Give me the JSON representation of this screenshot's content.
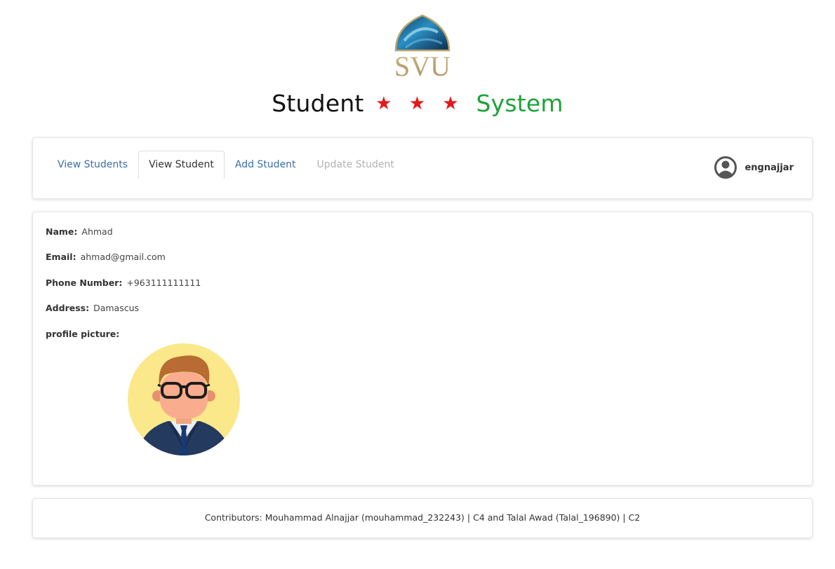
{
  "header": {
    "logo_text": "SVU",
    "title_part1": "Student",
    "title_stars": "★ ★ ★",
    "title_part2": "System"
  },
  "nav": {
    "tabs": [
      {
        "label": "View Students",
        "state": "link"
      },
      {
        "label": "View Student",
        "state": "active"
      },
      {
        "label": "Add Student",
        "state": "link"
      },
      {
        "label": "Update Student",
        "state": "disabled"
      }
    ],
    "user": {
      "name": "engnajjar",
      "icon": "user-circle-icon"
    }
  },
  "student": {
    "name_label": "Name:",
    "name": "Ahmad",
    "email_label": "Email:",
    "email": "ahmad@gmail.com",
    "phone_label": "Phone Number:",
    "phone": "+963111111111",
    "address_label": "Address:",
    "address": "Damascus",
    "picture_label": "profile picture:"
  },
  "footer": {
    "text": "Contributors: Mouhammad Alnajjar (mouhammad_232243) | C4 and Talal Awad (Talal_196890) | C2"
  },
  "colors": {
    "title_stars": "#e61919",
    "title_system": "#1fa23a",
    "tab_link": "#3d6fa5",
    "tab_disabled": "#b3b3b3"
  }
}
